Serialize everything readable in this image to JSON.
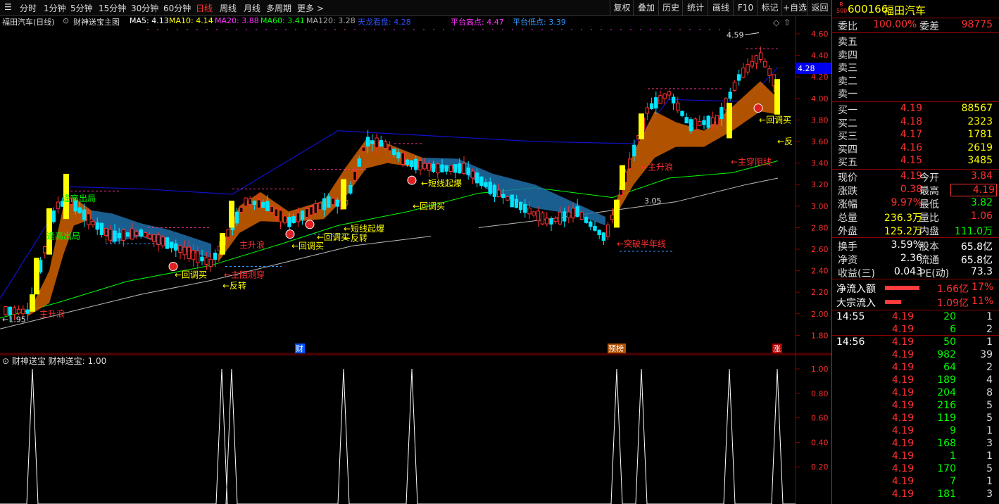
{
  "toolbar": {
    "tabs": [
      "分时",
      "1分钟",
      "5分钟",
      "15分钟",
      "30分钟",
      "60分钟",
      "日线",
      "周线",
      "月线",
      "多周期",
      "更多 >"
    ],
    "active_tab": "日线",
    "buttons": [
      "复权",
      "叠加",
      "历史",
      "统计",
      "画线",
      "F10",
      "标记",
      "+自选",
      "返回"
    ]
  },
  "legend": {
    "title": "福田汽车(日线)",
    "indicator": "财神送宝主图",
    "ma5": "MA5: 4.13",
    "ma10": "MA10: 4.14",
    "ma20": "MA20: 3.88",
    "ma60": "MA60: 3.41",
    "ma120": "MA120: 3.28",
    "tianlong": "天龙看盘: 4.28",
    "platform_high": "平台高点: 4.47",
    "platform_low": "平台低点: 3.39"
  },
  "price_axis": [
    "4.60",
    "4.40",
    "4.20",
    "4.00",
    "3.80",
    "3.60",
    "3.40",
    "3.20",
    "3.00",
    "2.80",
    "2.60",
    "2.40",
    "2.20",
    "2.00",
    "1.80"
  ],
  "current_price_tag": "4.28",
  "chart_labels": {
    "high_price": "4.59",
    "low_price": "1.95",
    "mid_price": "3.05",
    "events": [
      "财",
      "预榜",
      "涨"
    ]
  },
  "annotations": [
    "主升浪",
    "逢高出局",
    "逢高出局",
    "主升浪",
    "←回调买",
    "←主阻测穿",
    "←反转",
    "←回调买",
    "←回调买",
    "←反转",
    "←短线起爆",
    "←短线起爆",
    "←回调买",
    "←突破半年线",
    "←主升浪",
    "←主穿阻线",
    "←回调买",
    "←反"
  ],
  "sub_panel": {
    "title": "财神送宝",
    "value_label": "财神送宝: 1.00",
    "axis": [
      "1.00",
      "0.80",
      "0.60",
      "0.40",
      "0.20"
    ]
  },
  "quote": {
    "code": "600166",
    "name": "福田汽车",
    "badge_top": "R",
    "badge_bottom": "500",
    "weibi_label": "委比",
    "weibi": "100.00%",
    "weicha_label": "委差",
    "weicha": "98775",
    "sells": [
      {
        "label": "卖五",
        "price": "",
        "vol": ""
      },
      {
        "label": "卖四",
        "price": "",
        "vol": ""
      },
      {
        "label": "卖三",
        "price": "",
        "vol": ""
      },
      {
        "label": "卖二",
        "price": "",
        "vol": ""
      },
      {
        "label": "卖一",
        "price": "",
        "vol": ""
      }
    ],
    "buys": [
      {
        "label": "买一",
        "price": "4.19",
        "vol": "88567"
      },
      {
        "label": "买二",
        "price": "4.18",
        "vol": "2323"
      },
      {
        "label": "买三",
        "price": "4.17",
        "vol": "1781"
      },
      {
        "label": "买四",
        "price": "4.16",
        "vol": "2619"
      },
      {
        "label": "买五",
        "price": "4.15",
        "vol": "3485"
      }
    ],
    "stats": [
      {
        "l1": "现价",
        "v1": "4.19",
        "l2": "今开",
        "v2": "3.84"
      },
      {
        "l1": "涨跌",
        "v1": "0.38",
        "l2": "最高",
        "v2": "4.19"
      },
      {
        "l1": "涨幅",
        "v1": "9.97%",
        "l2": "最低",
        "v2": "3.82"
      },
      {
        "l1": "总量",
        "v1": "236.3万",
        "l2": "量比",
        "v2": "1.06"
      },
      {
        "l1": "外盘",
        "v1": "125.2万",
        "l2": "内盘",
        "v2": "111.0万"
      }
    ],
    "stats2": [
      {
        "l1": "换手",
        "v1": "3.59%",
        "l2": "股本",
        "v2": "65.8亿"
      },
      {
        "l1": "净资",
        "v1": "2.36",
        "l2": "流通",
        "v2": "65.8亿"
      },
      {
        "l1": "收益(三)",
        "v1": "0.043",
        "l2": "PE(动)",
        "v2": "73.3"
      }
    ],
    "flows": [
      {
        "label": "净流入额",
        "value": "1.66亿",
        "pct": "17%",
        "bar": 0.9
      },
      {
        "label": "大宗流入",
        "value": "1.09亿",
        "pct": "11%",
        "bar": 0.42
      }
    ],
    "ticks": [
      {
        "time": "14:55",
        "price": "4.19",
        "vol": "20",
        "n": "1"
      },
      {
        "time": "",
        "price": "4.19",
        "vol": "6",
        "n": "2"
      },
      {
        "time": "14:56",
        "price": "4.19",
        "vol": "50",
        "n": "1"
      },
      {
        "time": "",
        "price": "4.19",
        "vol": "982",
        "n": "39"
      },
      {
        "time": "",
        "price": "4.19",
        "vol": "64",
        "n": "2"
      },
      {
        "time": "",
        "price": "4.19",
        "vol": "189",
        "n": "4"
      },
      {
        "time": "",
        "price": "4.19",
        "vol": "204",
        "n": "8"
      },
      {
        "time": "",
        "price": "4.19",
        "vol": "216",
        "n": "5"
      },
      {
        "time": "",
        "price": "4.19",
        "vol": "119",
        "n": "5"
      },
      {
        "time": "",
        "price": "4.19",
        "vol": "9",
        "n": "1"
      },
      {
        "time": "",
        "price": "4.19",
        "vol": "168",
        "n": "3"
      },
      {
        "time": "",
        "price": "4.19",
        "vol": "1",
        "n": "1"
      },
      {
        "time": "",
        "price": "4.19",
        "vol": "170",
        "n": "5"
      },
      {
        "time": "",
        "price": "4.19",
        "vol": "7",
        "n": "1"
      },
      {
        "time": "",
        "price": "4.19",
        "vol": "181",
        "n": "3"
      }
    ]
  },
  "colors": {
    "up": "#ff3030",
    "down": "#00e5ff",
    "yellow": "#ffff00",
    "green": "#00ff00",
    "accent": "#0000ff"
  }
}
